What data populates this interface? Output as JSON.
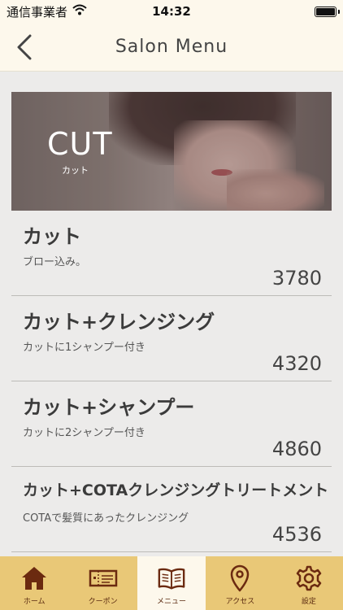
{
  "status_bar": {
    "carrier": "通信事業者",
    "time": "14:32"
  },
  "nav": {
    "title": "Salon Menu"
  },
  "hero": {
    "title": "CUT",
    "subtitle": "カット"
  },
  "menu_items": [
    {
      "name": "カット",
      "description": "ブロー込み。",
      "price": "3780"
    },
    {
      "name": "カット+クレンジング",
      "description": "カットに1シャンプー付き",
      "price": "4320"
    },
    {
      "name": "カット+シャンプー",
      "description": "カットに2シャンプー付き",
      "price": "4860"
    },
    {
      "name": "カット+COTAクレンジングトリートメント",
      "description": "COTAで髪質にあったクレンジング",
      "price": "4536"
    }
  ],
  "tabs": [
    {
      "label": "ホーム",
      "icon": "home-icon"
    },
    {
      "label": "クーポン",
      "icon": "ticket-icon"
    },
    {
      "label": "メニュー",
      "icon": "book-icon",
      "active": true
    },
    {
      "label": "アクセス",
      "icon": "map-pin-icon"
    },
    {
      "label": "設定",
      "icon": "gear-icon"
    }
  ],
  "colors": {
    "tab_bar": "#e9c877",
    "tab_active": "#fdf8ec",
    "icon": "#6b2a10",
    "background": "#ecebea"
  }
}
